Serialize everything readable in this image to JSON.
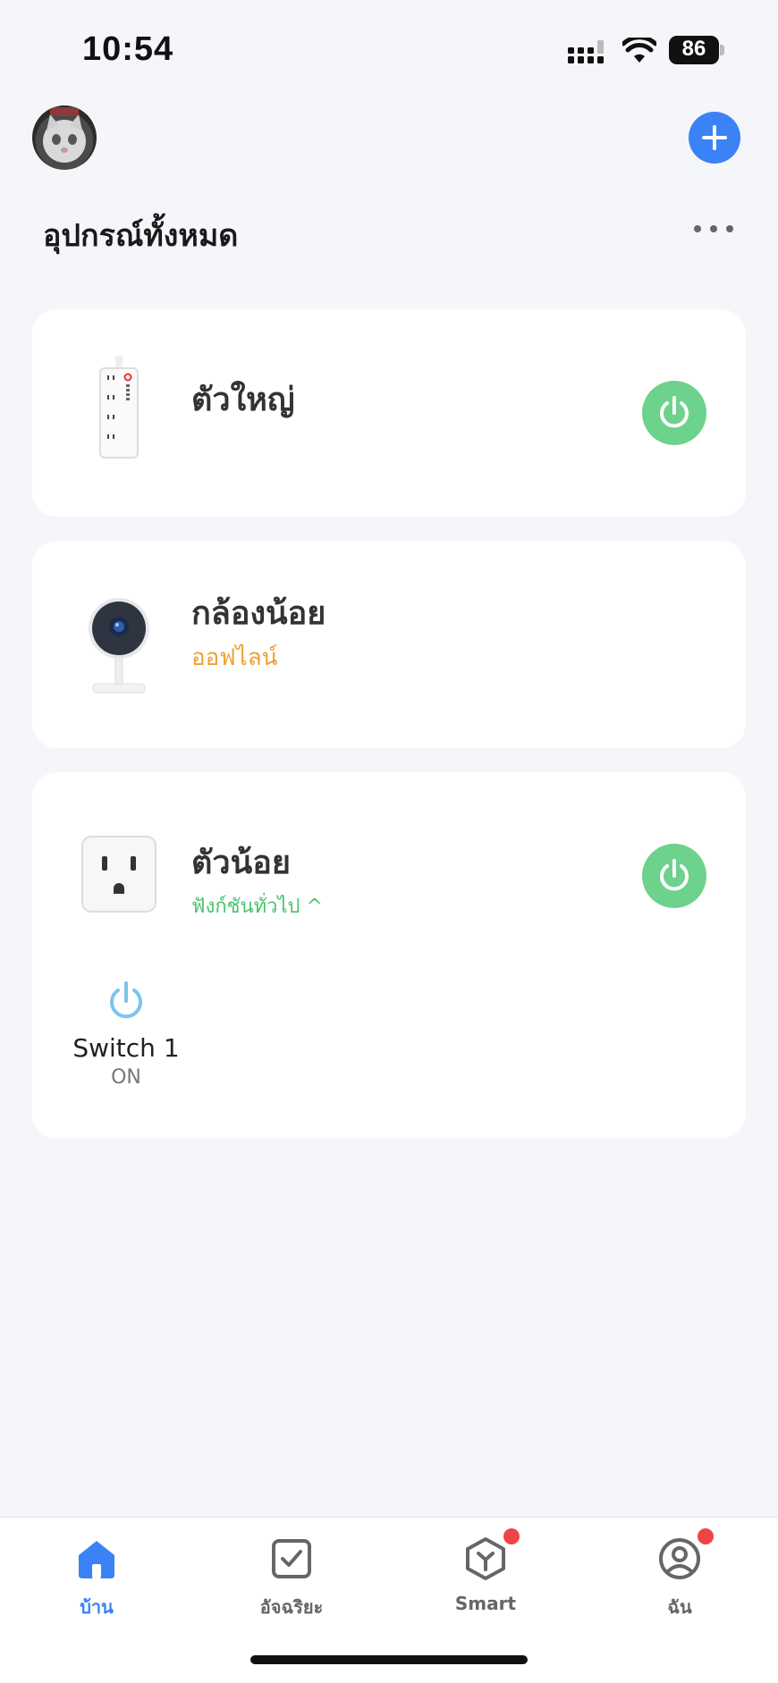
{
  "status_bar": {
    "time": "10:54",
    "battery": "86"
  },
  "header": {
    "title": "อุปกรณ์ทั้งหมด"
  },
  "devices": [
    {
      "name": "ตัวใหญ่",
      "status": "",
      "icon": "power-strip",
      "power": "on"
    },
    {
      "name": "กล้องน้อย",
      "status": "ออฟไลน์",
      "icon": "camera",
      "status_color": "#f0a030"
    },
    {
      "name": "ตัวน้อย",
      "status": "ฟังก์ชันทั่วไป ^",
      "icon": "smart-plug",
      "power": "on",
      "switches": [
        {
          "label": "Switch 1",
          "state": "ON"
        }
      ]
    }
  ],
  "nav": [
    {
      "label": "บ้าน",
      "icon": "home-icon",
      "active": true
    },
    {
      "label": "อัจฉริยะ",
      "icon": "checkbox-icon"
    },
    {
      "label": "Smart",
      "icon": "cube-icon",
      "badge": true
    },
    {
      "label": "ฉัน",
      "icon": "profile-icon",
      "badge": true
    }
  ],
  "colors": {
    "accent": "#3b82f6",
    "power_on": "#6dd28c",
    "offline": "#f0a030",
    "badge": "#ef4444"
  }
}
